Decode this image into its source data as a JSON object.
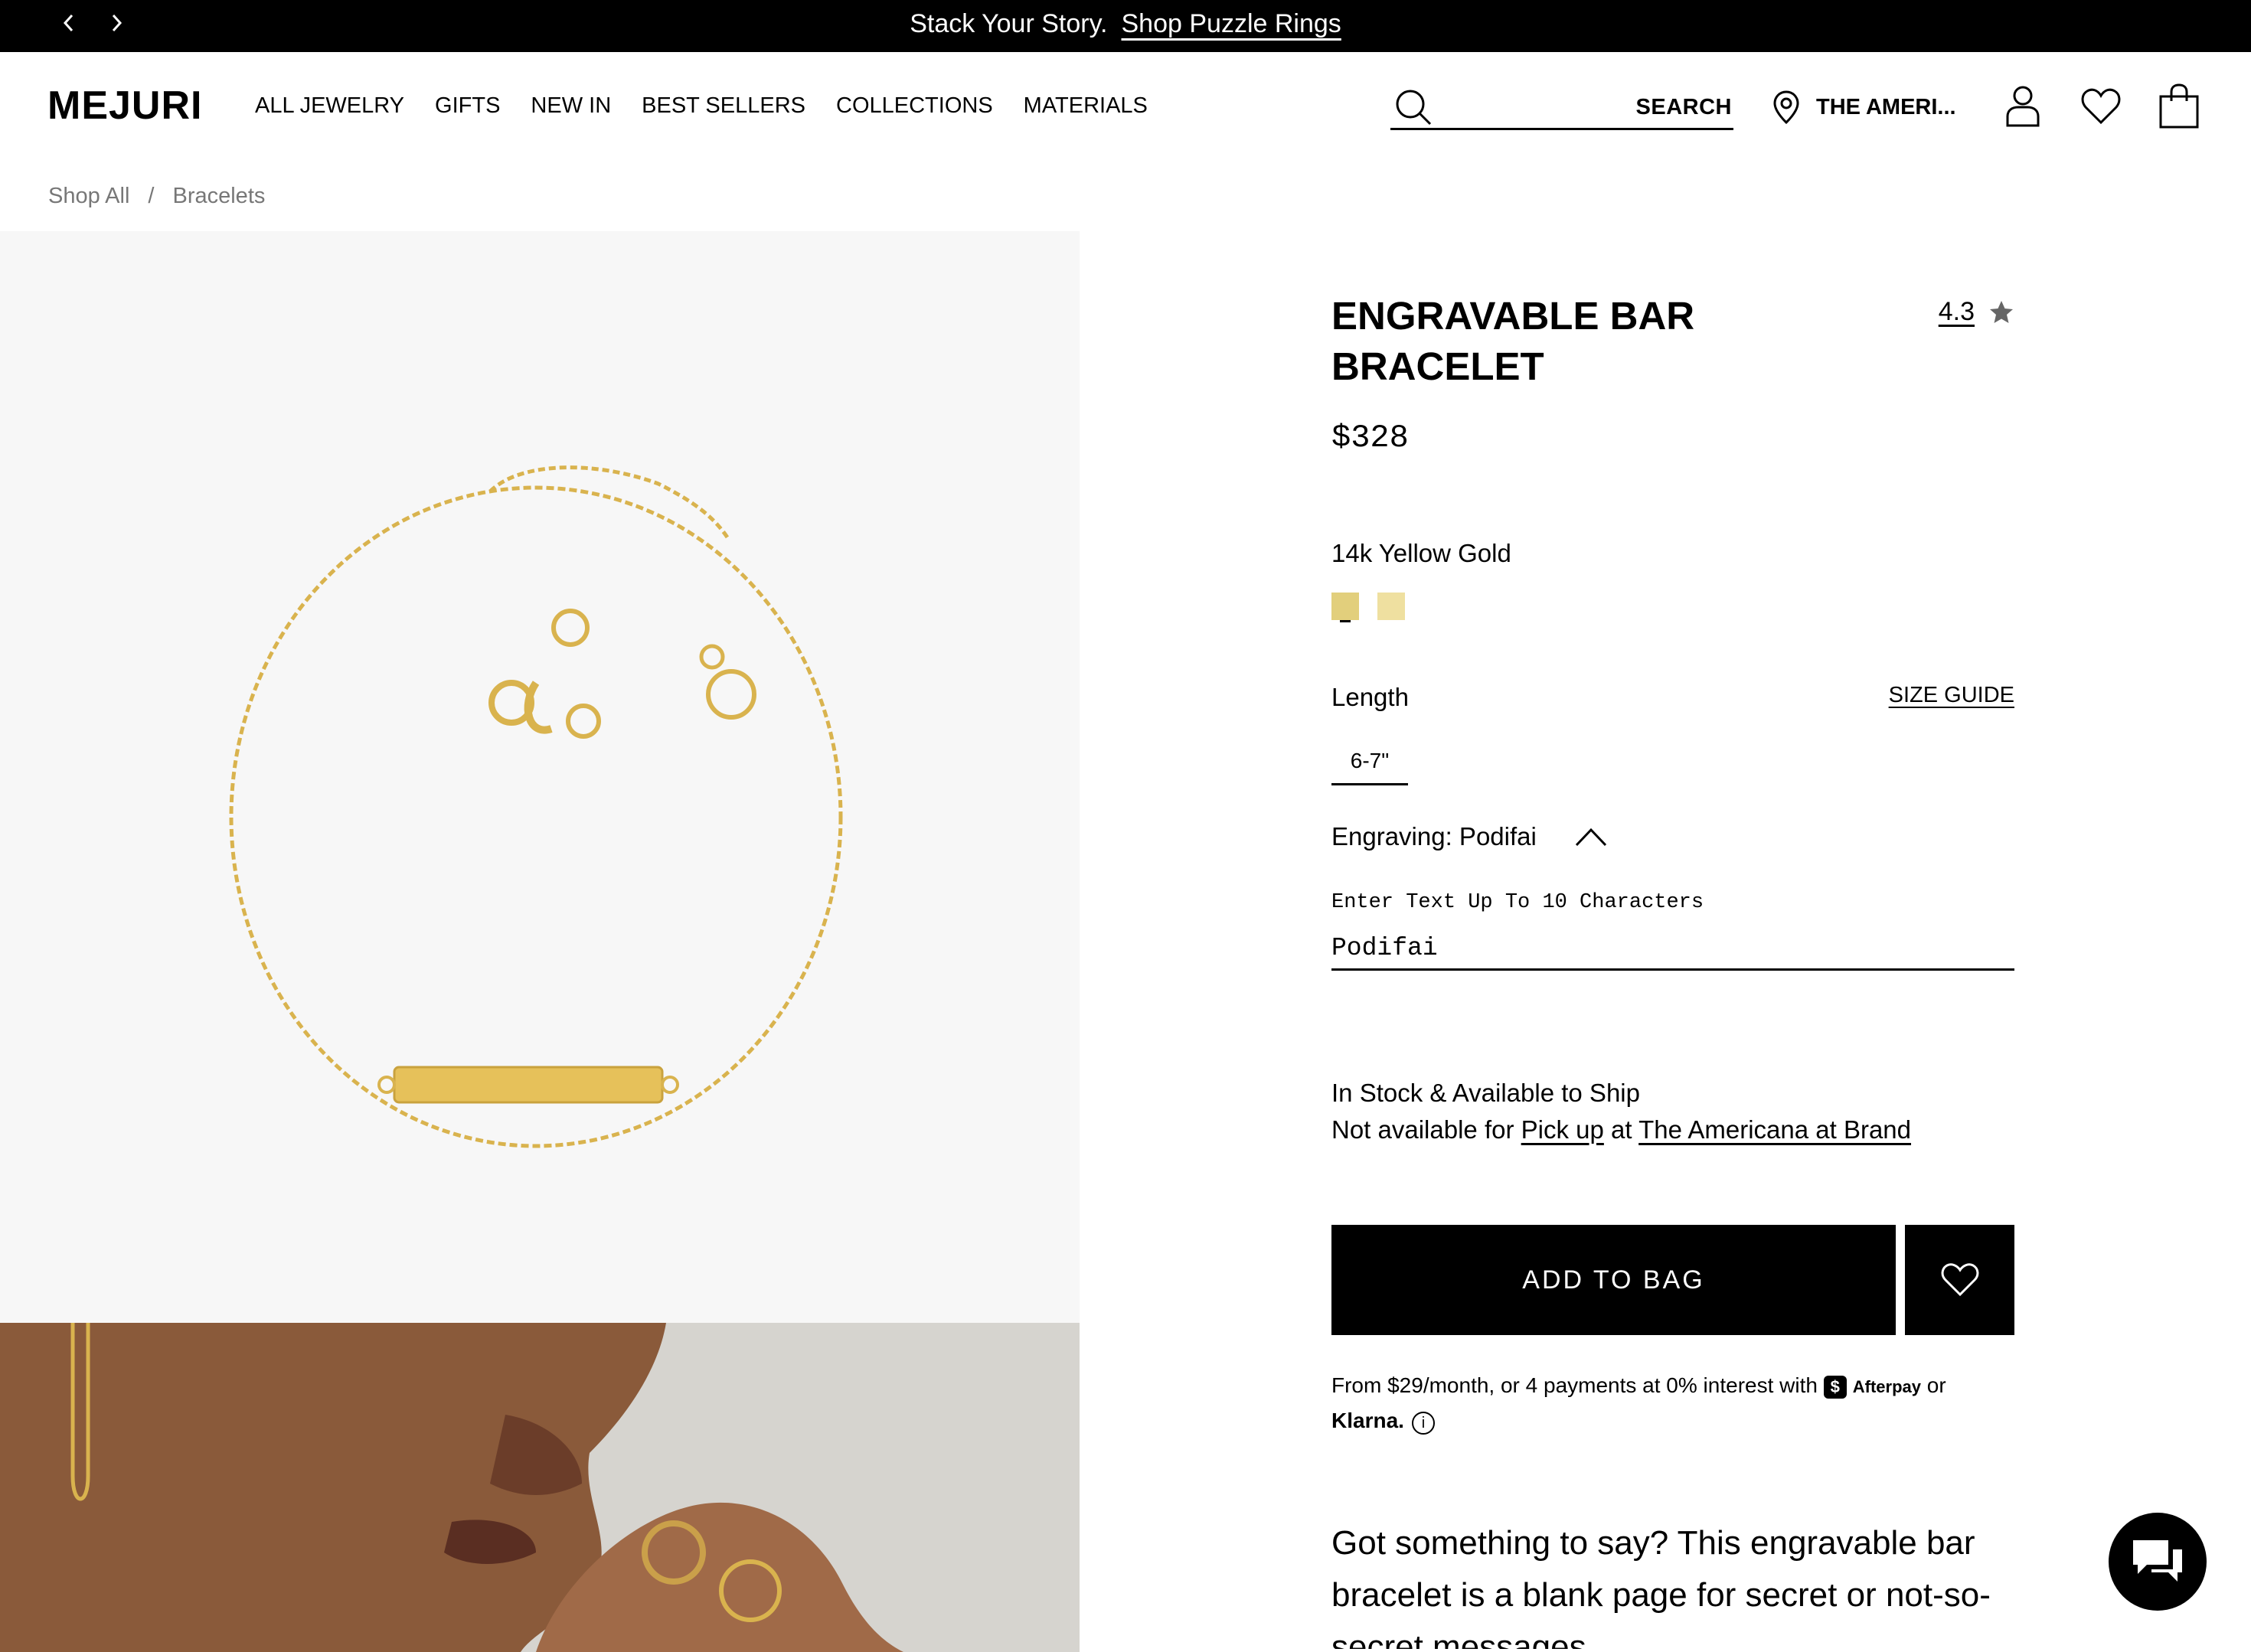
{
  "promo": {
    "text": "Stack Your Story.",
    "link": "Shop Puzzle Rings"
  },
  "header": {
    "logo": "MEJURI",
    "nav": [
      "ALL JEWELRY",
      "GIFTS",
      "NEW IN",
      "BEST SELLERS",
      "COLLECTIONS",
      "MATERIALS"
    ],
    "search_label": "SEARCH",
    "store": "THE AMERI..."
  },
  "breadcrumb": {
    "items": [
      "Shop All",
      "Bracelets"
    ],
    "separator": "/"
  },
  "product": {
    "title": "ENGRAVABLE BAR BRACELET",
    "rating": "4.3",
    "price": "$328",
    "metal": "14k Yellow Gold",
    "swatch_colors": [
      "#e2cf7c",
      "#efe0a0"
    ],
    "length_label": "Length",
    "size_guide": "SIZE GUIDE",
    "length_value": "6-7\"",
    "engraving_label": "Engraving: Podifai",
    "engraving_field_label": "Enter Text Up To 10 Characters",
    "engraving_value": "Podifai",
    "stock_line": "In Stock & Available to Ship",
    "pickup_prefix": "Not available for",
    "pickup_link": "Pick up",
    "pickup_at": "at",
    "store_link": "The Americana at Brand",
    "add_to_bag": "ADD TO BAG",
    "pay_text": "From $29/month, or 4 payments at 0% interest with",
    "afterpay_badge": "$",
    "afterpay": "Afterpay",
    "pay_or": "or",
    "klarna": "Klarna.",
    "info_glyph": "i",
    "description": "Got something to say? This engravable bar bracelet is a blank page for secret or not-so-secret messages."
  },
  "colors": {
    "accent": "#000000",
    "image_bg": "#f7f7f7",
    "gold": "#d9b34e"
  }
}
